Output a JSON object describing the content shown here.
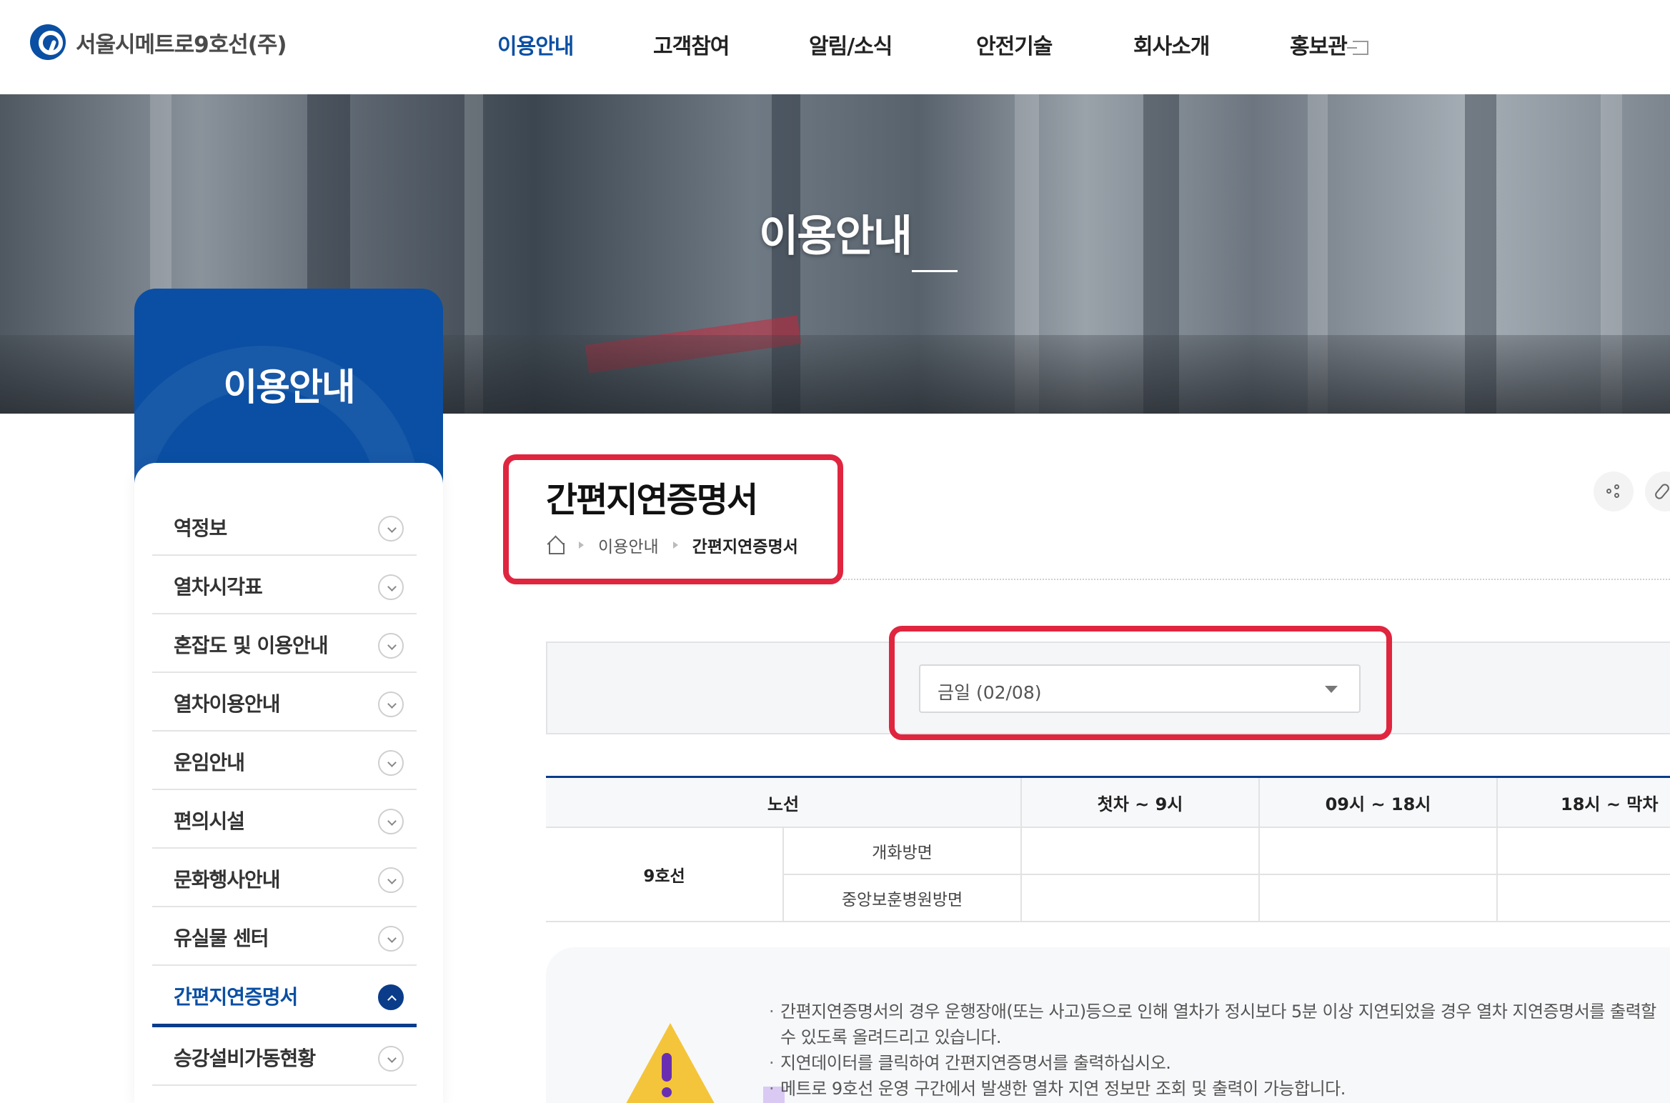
{
  "header": {
    "logo_text": "서울시메트로9호선(주)",
    "nav": [
      "이용안내",
      "고객참여",
      "알림/소식",
      "안전기술",
      "회사소개",
      "홍보관"
    ],
    "active_nav": "이용안내"
  },
  "hero": {
    "title": "이용안내"
  },
  "sidebar": {
    "title": "이용안내",
    "items": [
      {
        "label": "역정보"
      },
      {
        "label": "열차시각표"
      },
      {
        "label": "혼잡도 및 이용안내"
      },
      {
        "label": "열차이용안내"
      },
      {
        "label": "운임안내"
      },
      {
        "label": "편의시설"
      },
      {
        "label": "문화행사안내"
      },
      {
        "label": "유실물 센터"
      },
      {
        "label": "간편지연증명서"
      },
      {
        "label": "승강설비가동현황"
      }
    ],
    "active_item": "간편지연증명서"
  },
  "content": {
    "page_title": "간편지연증명서",
    "breadcrumb": [
      "이용안내",
      "간편지연증명서"
    ],
    "date_select": {
      "value": "금일 (02/08)"
    },
    "table": {
      "headers": [
        "노선",
        "첫차 ~ 9시",
        "09시 ~ 18시",
        "18시 ~ 막차"
      ],
      "line": "9호선",
      "rows": [
        {
          "direction": "개화방면"
        },
        {
          "direction": "중앙보훈병원방면"
        }
      ]
    },
    "notices": [
      "간편지연증명서의 경우 운행장애(또는 사고)등으로 인해 열차가 정시보다 5분 이상 지연되었을 경우 열차 지연증명서를 출력할 수 있도록 올려드리고 있습니다.",
      "지연데이터를 클릭하여 간편지연증명서를 출력하십시오.",
      "메트로 9호선 운영 구간에서 발생한 열차 지연 정보만 조회 및 출력이 가능합니다."
    ]
  },
  "colors": {
    "brand": "#0a4fa3",
    "highlight": "#e0253f",
    "warning": "#f4c53a"
  },
  "icons": {
    "home": "home-icon",
    "share": "share-icon",
    "attach": "paperclip-icon",
    "external": "external-link-icon"
  }
}
